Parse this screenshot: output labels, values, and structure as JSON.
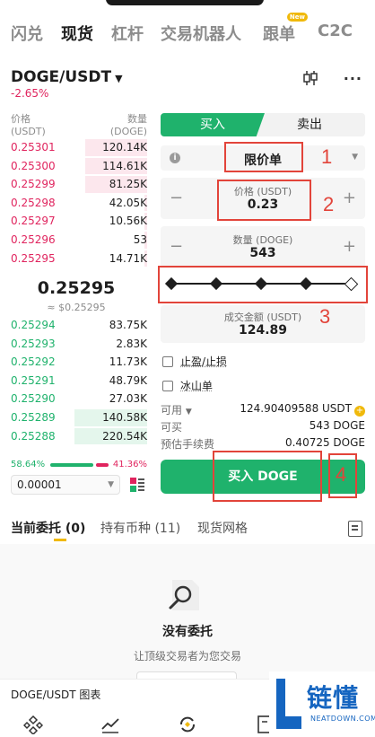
{
  "nav": {
    "tabs": [
      {
        "label": "闪兑",
        "active": false
      },
      {
        "label": "现货",
        "active": true
      },
      {
        "label": "杠杆",
        "active": false
      },
      {
        "label": "交易机器人",
        "active": false
      },
      {
        "label": "跟单",
        "active": false,
        "badge": "New"
      },
      {
        "label": "C2C",
        "active": false
      }
    ]
  },
  "pair": {
    "name": "DOGE/USDT",
    "change": "-2.65%",
    "icons": [
      "candlestick-icon",
      "more-icon"
    ]
  },
  "orderbook": {
    "price_header": "价格",
    "price_unit": "(USDT)",
    "qty_header": "数量",
    "qty_unit": "(DOGE)",
    "asks": [
      {
        "price": "0.25301",
        "qty": "120.14K",
        "depth": 0.46
      },
      {
        "price": "0.25300",
        "qty": "114.61K",
        "depth": 0.46
      },
      {
        "price": "0.25299",
        "qty": "81.25K",
        "depth": 0.46
      },
      {
        "price": "0.25298",
        "qty": "42.05K",
        "depth": 0.02
      },
      {
        "price": "0.25297",
        "qty": "10.56K",
        "depth": 0.02
      },
      {
        "price": "0.25296",
        "qty": "53",
        "depth": 0.02
      },
      {
        "price": "0.25295",
        "qty": "14.71K",
        "depth": 0.02
      }
    ],
    "last_price": "0.25295",
    "last_price_usd": "≈ $0.25295",
    "bids": [
      {
        "price": "0.25294",
        "qty": "83.75K",
        "depth": 0.0
      },
      {
        "price": "0.25293",
        "qty": "2.83K",
        "depth": 0.0
      },
      {
        "price": "0.25292",
        "qty": "11.73K",
        "depth": 0.0
      },
      {
        "price": "0.25291",
        "qty": "48.79K",
        "depth": 0.0
      },
      {
        "price": "0.25290",
        "qty": "27.03K",
        "depth": 0.0
      },
      {
        "price": "0.25289",
        "qty": "140.58K",
        "depth": 0.54
      },
      {
        "price": "0.25288",
        "qty": "220.54K",
        "depth": 0.54
      }
    ],
    "buy_ratio": "58.64%",
    "sell_ratio": "41.36%",
    "precision": "0.00001"
  },
  "form": {
    "buy_tab": "买入",
    "sell_tab": "卖出",
    "order_type": "限价单",
    "price_label": "价格 (USDT)",
    "price_value": "0.23",
    "qty_label": "数量 (DOGE)",
    "qty_value": "543",
    "slider_positions": 5,
    "slider_selected": 1.0,
    "total_label": "成交金额 (USDT)",
    "total_value": "124.89",
    "tp_sl_label": "止盈/止损",
    "iceberg_label": "冰山单",
    "available_label": "可用",
    "available_value": "124.90409588 USDT",
    "can_buy_label": "可买",
    "can_buy_value": "543 DOGE",
    "fee_label": "预估手续费",
    "fee_value": "0.40725 DOGE",
    "buy_button": "买入 DOGE"
  },
  "annotations": {
    "one": "1",
    "two": "2",
    "three": "3",
    "four": "4",
    "color": "#e2443a"
  },
  "bottom_tabs": {
    "open_orders": "当前委托 (0)",
    "holdings": "持有币种 (11)",
    "grid": "现货网格"
  },
  "empty": {
    "title": "没有委托",
    "subtitle": "让顶级交易者为您交易"
  },
  "chart_bar": {
    "label": "DOGE/USDT 图表"
  },
  "watermark": {
    "text": "链懂",
    "sub": "NEATDOWN.COM"
  },
  "colors": {
    "buy": "#1fb26c",
    "sell": "#e0245e",
    "accent": "#f0b90b"
  }
}
